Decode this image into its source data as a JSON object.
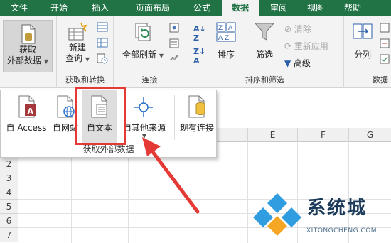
{
  "ribbon_tabs": [
    "文件",
    "开始",
    "插入",
    "页面布局",
    "公式",
    "数据",
    "审阅",
    "视图",
    "帮助"
  ],
  "active_tab": "数据",
  "groups": {
    "get_external": {
      "label_line1": "获取",
      "label_line2": "外部数据"
    },
    "get_transform": {
      "label": "获取和转换",
      "new_query_line1": "新建",
      "new_query_line2": "查询"
    },
    "connections": {
      "label": "连接",
      "refresh_all": "全部刷新"
    },
    "sort_filter": {
      "label": "排序和筛选",
      "sort": "排序",
      "filter": "筛选",
      "clear": "清除",
      "reapply": "重新应用",
      "advanced": "高级"
    },
    "data_tools": {
      "label": "数据",
      "split": "分列"
    }
  },
  "dropdown": {
    "items": [
      "自 Access",
      "自网站",
      "自文本",
      "自其他来源",
      "现有连接"
    ],
    "label": "获取外部数据"
  },
  "sheet": {
    "columns": [
      "E",
      "F",
      "G"
    ],
    "rows": [
      "2",
      "3",
      "4",
      "5",
      "6",
      "7"
    ]
  },
  "watermark": {
    "title": "系统城",
    "subtitle": "XITONGCHENG.COM"
  },
  "colors": {
    "accent": "#217346",
    "highlight": "#e53935"
  }
}
